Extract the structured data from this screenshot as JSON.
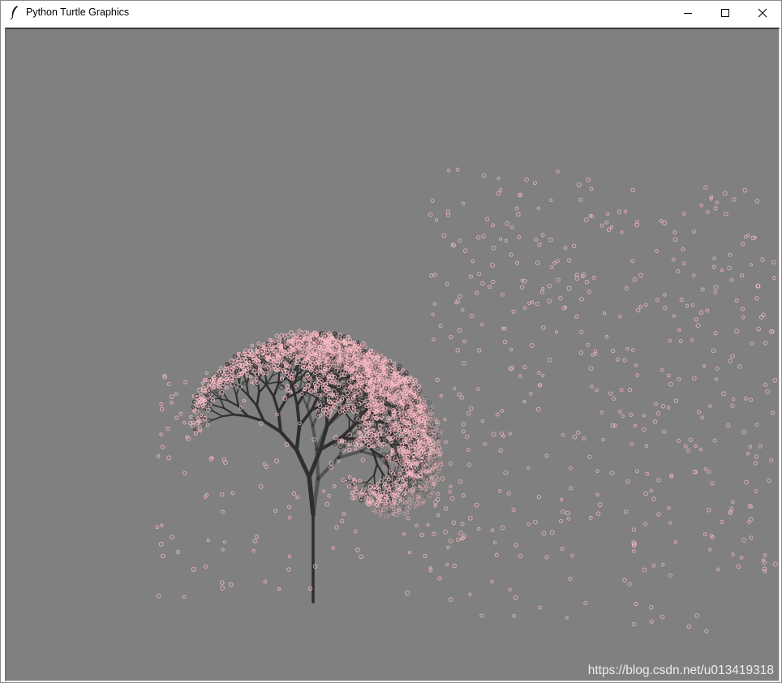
{
  "window": {
    "title": "Python Turtle Graphics",
    "icon": "feather-icon",
    "controls": [
      "minimize-icon",
      "maximize-icon",
      "close-icon"
    ]
  },
  "canvas": {
    "background_color": "#808080",
    "branch_color": "#2f2f2f",
    "blossom_color": "#f4b8c0",
    "content": "fractal-tree-with-blossoms"
  },
  "watermark": "https://blog.csdn.net/u013419318"
}
